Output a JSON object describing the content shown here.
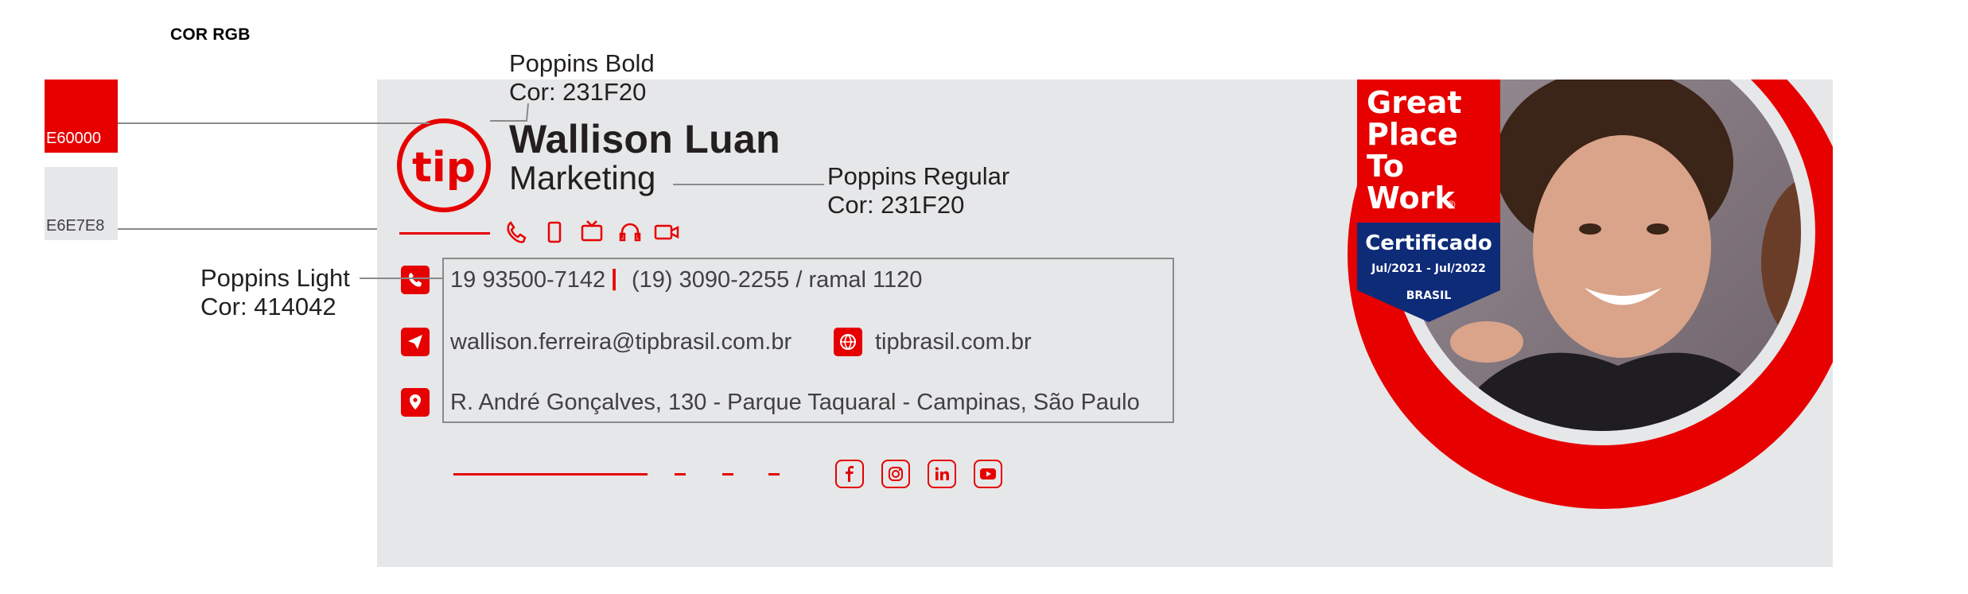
{
  "legend": {
    "title": "COR RGB",
    "swatches": [
      {
        "code": "E60000",
        "color": "#E60000"
      },
      {
        "code": "E6E7E8",
        "color": "#E6E7E8"
      }
    ]
  },
  "callouts": {
    "bold": {
      "font": "Poppins Bold",
      "color": "Cor: 231F20"
    },
    "regular": {
      "font": "Poppins Regular",
      "color": "Cor: 231F20"
    },
    "light": {
      "font": "Poppins Light",
      "color": "Cor: 414042"
    }
  },
  "signature": {
    "logo_text": "tip",
    "name": "Wallison Luan",
    "role": "Marketing",
    "top_icons": [
      "phone-icon",
      "mobile-icon",
      "tv-icon",
      "headset-icon",
      "video-camera-icon"
    ],
    "phone": "19 93500-7142",
    "phone_separator": "|",
    "phone2": "(19) 3090-2255 / ramal 1120",
    "email": "wallison.ferreira@tipbrasil.com.br",
    "website": "tipbrasil.com.br",
    "address": "R. André Gonçalves, 130 - Parque Taquaral - Campinas, São Paulo",
    "social_icons": [
      "facebook-icon",
      "instagram-icon",
      "linkedin-icon",
      "youtube-icon"
    ]
  },
  "badge": {
    "line1": "Great",
    "line2": "Place",
    "line3": "To",
    "line4": "Work",
    "registered": "®",
    "certified": "Certificado",
    "period": "Jul/2021 - Jul/2022",
    "country": "BRASIL"
  },
  "colors": {
    "accent": "#E60000",
    "card_bg": "#E6E7E8",
    "text_dark": "#231F20",
    "text_body": "#414042",
    "badge_blue": "#0E2B78"
  }
}
